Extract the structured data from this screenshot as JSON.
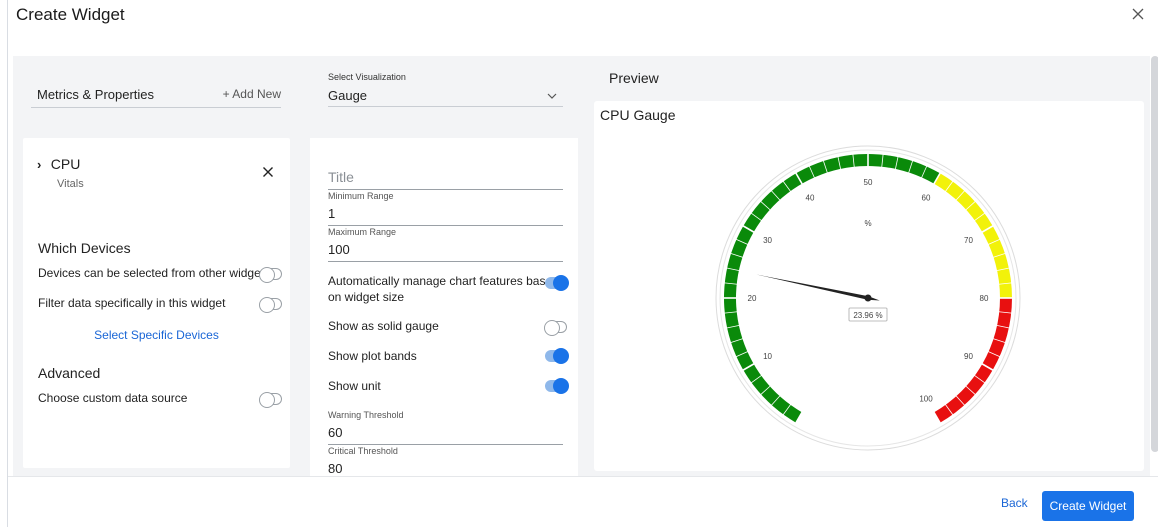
{
  "dialog": {
    "title": "Create Widget",
    "close_icon": "close-icon"
  },
  "metrics": {
    "title": "Metrics & Properties",
    "add_new": "+ Add New",
    "item": {
      "name": "CPU",
      "sub": "Vitals"
    }
  },
  "devices": {
    "heading": "Which Devices",
    "opt_other_widgets": "Devices can be selected from other widgets",
    "opt_filter": "Filter data specifically in this widget",
    "select_specific": "Select Specific Devices"
  },
  "advanced": {
    "heading": "Advanced",
    "opt_custom_source": "Choose custom data source"
  },
  "visualization": {
    "label": "Select Visualization",
    "value": "Gauge"
  },
  "config": {
    "title_placeholder": "Title",
    "min_range_label": "Minimum Range",
    "min_range_value": "1",
    "max_range_label": "Maximum Range",
    "max_range_value": "100",
    "auto_manage_line1": "Automatically manage chart features based",
    "auto_manage_line2": "on widget size",
    "solid_gauge": "Show as solid gauge",
    "plot_bands": "Show plot bands",
    "show_unit": "Show unit",
    "warning_label": "Warning Threshold",
    "warning_value": "60",
    "critical_label": "Critical Threshold",
    "critical_value": "80"
  },
  "preview": {
    "heading": "Preview",
    "title": "CPU Gauge"
  },
  "chart_data": {
    "type": "gauge",
    "title": "CPU Gauge",
    "unit": "%",
    "min": 0,
    "max": 100,
    "value": 23.96,
    "value_label": "23.96 %",
    "tick_labels": [
      "10",
      "20",
      "30",
      "40",
      "50",
      "60",
      "70",
      "80",
      "90",
      "100"
    ],
    "bands": [
      {
        "from": 0,
        "to": 60,
        "color": "#0a8a0a"
      },
      {
        "from": 60,
        "to": 80,
        "color": "#f2f20a"
      },
      {
        "from": 80,
        "to": 100,
        "color": "#e81010"
      }
    ]
  },
  "footer": {
    "back": "Back",
    "create": "Create Widget"
  },
  "colors": {
    "accent": "#1a73e8",
    "band_green": "#0a8a0a",
    "band_yellow": "#f2f20a",
    "band_red": "#e81010"
  }
}
